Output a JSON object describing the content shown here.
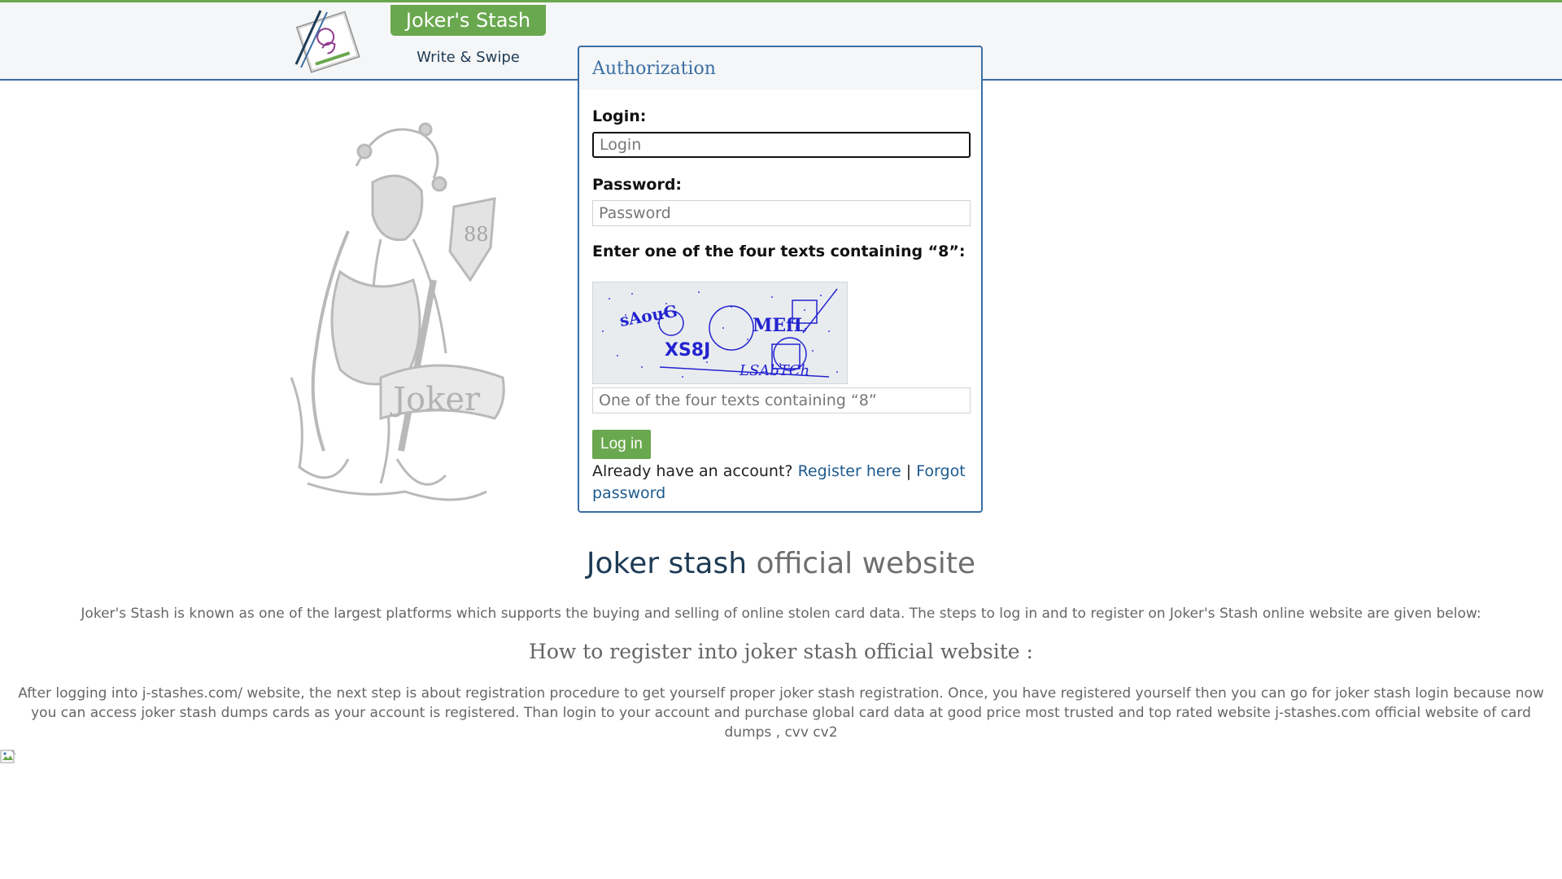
{
  "header": {
    "brand": "Joker's Stash",
    "tagline": "Write & Swipe"
  },
  "auth": {
    "title": "Authorization",
    "login_label": "Login:",
    "login_placeholder": "Login",
    "password_label": "Password:",
    "password_placeholder": "Password",
    "captcha_label": "Enter one of the four texts containing “8”:",
    "captcha_texts": [
      "sAouG",
      "MEfL",
      "XS8J",
      "LSAbTCh"
    ],
    "captcha_placeholder": "One of the four texts containing “8”",
    "login_button": "Log in",
    "account_text": "Already have an account?",
    "register_link": "Register here",
    "separator": "|",
    "forgot_link": "Forgot password"
  },
  "jester": {
    "banner_text": "Joker",
    "shield_text": "88"
  },
  "content": {
    "title_dark": "Joker stash",
    "title_grey": "official website",
    "intro": "Joker's Stash is known as one of the largest platforms which supports the buying and selling of online stolen card data. The steps to log in and to register on Joker's Stash online website are given below:",
    "heading": "How to register into joker stash official website :",
    "body": "After logging into j-stashes.com/ website, the next step is about registration procedure to get yourself proper joker stash registration. Once, you have registered yourself then you can go for joker stash login because now you can access joker stash dumps cards as your account is registered. Than login to your account and purchase global card data at good price most trusted and top rated website j-stashes.com official website of card dumps , cvv cv2"
  },
  "colors": {
    "accent_green": "#6aa84f",
    "border_blue": "#3a6ea5",
    "link_blue": "#1d5a8e",
    "captcha_blue": "#2323d0"
  },
  "icons": {
    "logo": "notebook-pen-logo-icon",
    "broken_image": "broken-image-icon"
  }
}
